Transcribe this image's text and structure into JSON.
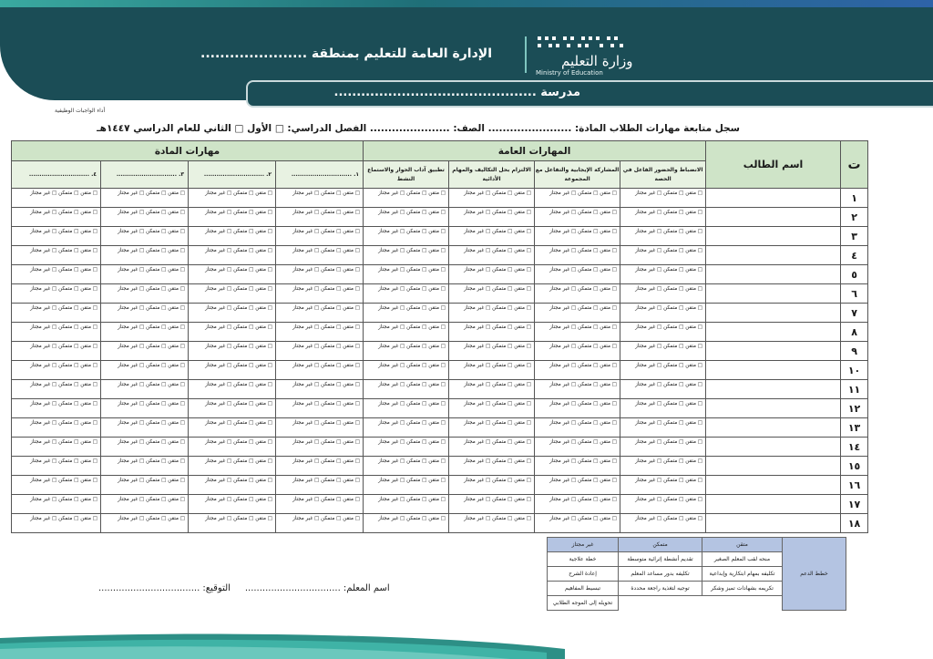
{
  "header": {
    "title": "الإدارة العامة للتعليم بمنطقة ......................",
    "school": "مدرسة .............................................",
    "logo_ar": "وزارة التعليم",
    "logo_en": "Ministry of Education",
    "small_note": "أداء الواجبات الوظيفية"
  },
  "info_line": "سجل متابعة مهارات الطلاب  المادة: .......................  الصف: ...................... الفصل الدراسي: □ الأول □ الثاني للعام الدراسي ١٤٤٧هـ",
  "table": {
    "col_num": "ت",
    "col_name": "اسم الطالب",
    "general_skills": "المهارات العامة",
    "subject_skills": "مهارات المادة",
    "general_cols": [
      "الانضباط والحضور الفاعل في الحصة",
      "المشاركة الإيجابية والتفاعل مع المجموعة",
      "الالتزام بحل التكاليف والمهام الأدائية",
      "تطبيق آداب الحوار والاستماع النشط"
    ],
    "subject_cols": [
      "١. .............................",
      "٢. .............................",
      "٣. .............................",
      "٤. ............................."
    ],
    "cell_text": "□ متقن □ متمكن □ غير مجتاز",
    "rows": [
      "١",
      "٢",
      "٣",
      "٤",
      "٥",
      "٦",
      "٧",
      "٨",
      "٩",
      "١٠",
      "١١",
      "١٢",
      "١٣",
      "١٤",
      "١٥",
      "١٦",
      "١٧",
      "١٨"
    ]
  },
  "teacher": {
    "name_label": "اسم المعلم: .................................",
    "signature_label": "التوقيع: ..................................."
  },
  "support": {
    "plan_label": "خطط الدعم",
    "headers": [
      "متقن",
      "متمكن",
      "غير مجتاز"
    ],
    "rows": [
      [
        "منحه لقب المعلم الصغير",
        "تقديم أنشطة إثرائية متوسطة",
        "خطة علاجية"
      ],
      [
        "تكليفه بمهام ابتكارية وإبداعية",
        "تكليفه بدور مساعد المعلم",
        "إعادة الشرح"
      ],
      [
        "تكريمه بشهادات تميز وشكر",
        "توجيه لتغذية راجعة محددة",
        "تبسيط المفاهيم"
      ],
      [
        "",
        "",
        "تحويله إلى الموجه الطلابي"
      ]
    ]
  },
  "colors": {
    "header_bg": "#1b4d56",
    "table_header": "#cfe4c8",
    "support_header": "#b4c4e2"
  }
}
